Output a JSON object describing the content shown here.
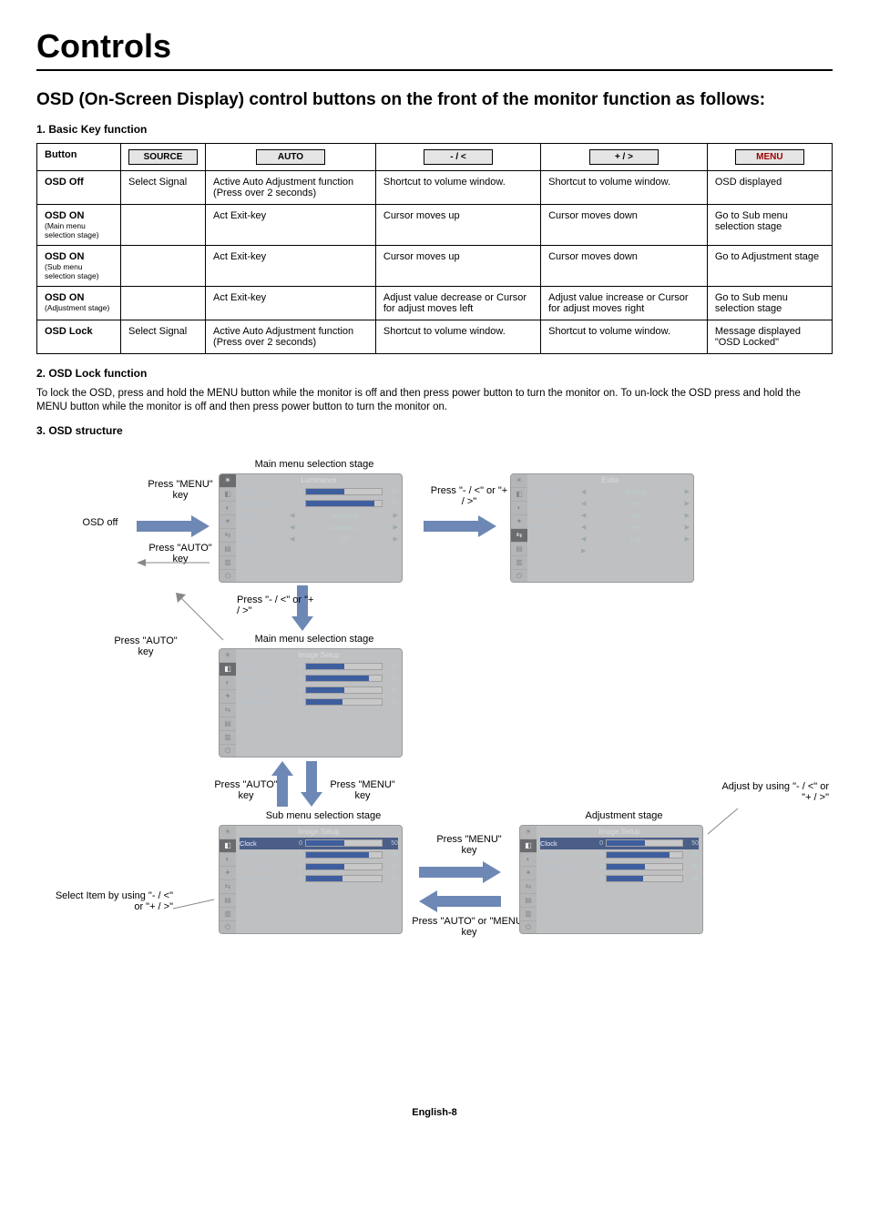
{
  "page_title": "Controls",
  "section_heading": "OSD (On-Screen Display) control buttons on the front of the monitor function as follows:",
  "sub1": "1. Basic Key function",
  "table": {
    "header": {
      "button": "Button",
      "source": "SOURCE",
      "auto": "AUTO",
      "minus": "- / <",
      "plus": "+ / >",
      "menu": "MENU"
    },
    "rows": [
      {
        "title": "OSD Off",
        "sub": "",
        "source": "Select Signal",
        "auto": "Active Auto Adjustment function (Press over 2 seconds)",
        "minus": "Shortcut to volume window.",
        "plus": "Shortcut to volume window.",
        "menu": "OSD displayed"
      },
      {
        "title": "OSD ON",
        "sub": "(Main menu selection stage)",
        "source": "",
        "auto": "Act Exit-key",
        "minus": "Cursor moves up",
        "plus": "Cursor moves down",
        "menu": "Go to Sub menu selection stage"
      },
      {
        "title": "OSD ON",
        "sub": "(Sub menu selection stage)",
        "source": "",
        "auto": "Act Exit-key",
        "minus": "Cursor moves up",
        "plus": "Cursor moves down",
        "menu": "Go to Adjustment stage"
      },
      {
        "title": "OSD ON",
        "sub": "(Adjustment stage)",
        "source": "",
        "auto": "Act Exit-key",
        "minus": "Adjust value decrease or Cursor for adjust moves left",
        "plus": "Adjust value increase or Cursor for adjust moves right",
        "menu": "Go to Sub menu selection stage"
      },
      {
        "title": "OSD Lock",
        "sub": "",
        "source": "Select Signal",
        "auto": "Active Auto Adjustment function (Press over 2 seconds)",
        "minus": "Shortcut to volume window.",
        "plus": "Shortcut to volume window.",
        "menu": "Message displayed \"OSD Locked\""
      }
    ]
  },
  "sub2": "2. OSD Lock function",
  "lock_text": "To lock the OSD, press and hold the MENU button while the monitor is off and then press power button to turn the monitor on. To un-lock the OSD press and hold the MENU button while the monitor is off and then press power button to turn the monitor on.",
  "sub3": "3. OSD structure",
  "flow_labels": {
    "osd_off": "OSD off",
    "press_menu": "Press \"MENU\" key",
    "press_auto": "Press \"AUTO\" key",
    "press_pm": "Press \"- / <\" or \"+ / >\"",
    "main_stage": "Main menu selection stage",
    "sub_stage": "Sub menu selection stage",
    "adj_stage": "Adjustment stage",
    "adjust_by": "Adjust by using \"- / <\" or \"+ / >\"",
    "select_item": "Select Item by using \"- / <\" or \"+ / >\"",
    "press_auto_or_menu": "Press \"AUTO\" or \"MENU\" key"
  },
  "osd_luminance": {
    "title": "Luminance",
    "rows": [
      {
        "name": "Contrast",
        "type": "bar",
        "val": 50
      },
      {
        "name": "Brightness",
        "type": "bar",
        "val": 90
      },
      {
        "name": "DV Mode",
        "type": "sel",
        "val": "Standard"
      },
      {
        "name": "Gamma",
        "type": "sel",
        "val": "Gamma 1"
      },
      {
        "name": "DCR",
        "type": "sel",
        "val": "Off"
      }
    ]
  },
  "osd_extra": {
    "title": "Extra",
    "rows": [
      {
        "name": "Input Select",
        "type": "sel",
        "val": "Analog"
      },
      {
        "name": "Auto Adjust",
        "type": "sel",
        "val": "Yes"
      },
      {
        "name": "DDC/CI",
        "type": "sel",
        "val": "Yes"
      },
      {
        "name": "Reset",
        "type": "sel",
        "val": "Yes"
      },
      {
        "name": "Aspect",
        "type": "sel",
        "val": "Full"
      },
      {
        "name": "Information",
        "type": "link",
        "val": "▶"
      }
    ]
  },
  "osd_image": {
    "title": "Image Setup",
    "rows": [
      {
        "name": "Clock",
        "type": "bar",
        "val": 50
      },
      {
        "name": "Focus",
        "type": "bar",
        "val": 83
      },
      {
        "name": "H.Position",
        "type": "bar",
        "val": 50
      },
      {
        "name": "V.Position",
        "type": "bar",
        "val": 48
      }
    ]
  },
  "footer": "English-8"
}
